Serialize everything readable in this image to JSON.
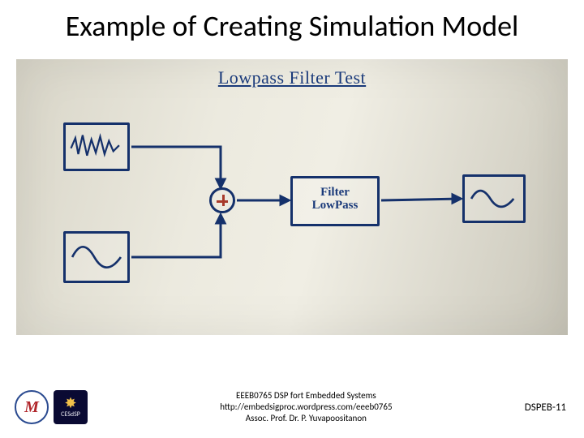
{
  "title": "Example of Creating Simulation Model",
  "whiteboard": {
    "heading": "Lowpass Filter Test",
    "filter_label_1": "Filter",
    "filter_label_2": "LowPass"
  },
  "footer": {
    "line1": "EEEB0765 DSP fort Embedded Systems",
    "line2": "http://embedsigproc.wordpress.com/eeeb0765",
    "line3": "Assoc. Prof. Dr. P. Yuvapoositanon",
    "page": "DSPEB-11"
  },
  "logos": {
    "uni_letter": "M",
    "cesdsp_label": "CESdSP"
  }
}
